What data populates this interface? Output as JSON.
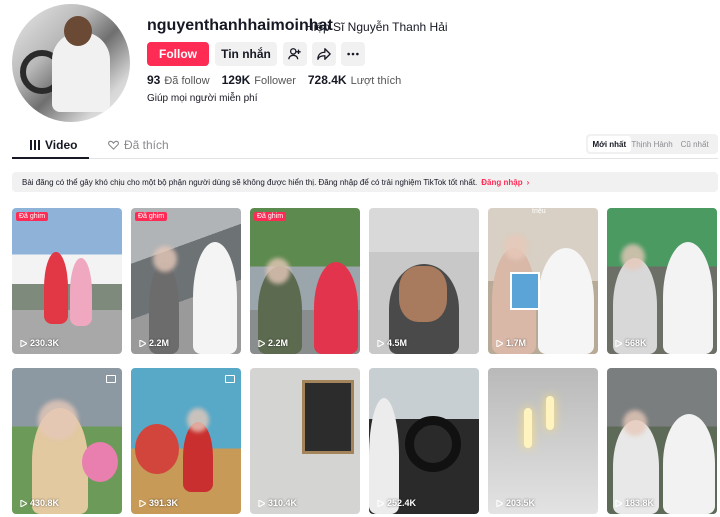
{
  "profile": {
    "username": "nguyenthanhhaimoinhat",
    "nickname": "Hiệp Sĩ Nguyễn Thanh Hải",
    "follow_label": "Follow",
    "message_label": "Tin nhắn",
    "stats": {
      "following_count": "93",
      "following_label": "Đã follow",
      "followers_count": "129K",
      "followers_label": "Follower",
      "likes_count": "728.4K",
      "likes_label": "Lượt thích"
    },
    "bio": "Giúp mọi người miễn phí"
  },
  "tabs": {
    "video": "Video",
    "liked": "Đã thích"
  },
  "sort": {
    "latest": "Mới nhất",
    "popular": "Thịnh Hành",
    "oldest": "Cũ nhất"
  },
  "notice": {
    "text": "Bài đăng có thể gây khó chịu cho một bộ phận người dùng sẽ không được hiển thị. Đăng nhập để có trải nghiệm TikTok tốt nhất.",
    "login": "Đăng nhập"
  },
  "videos": [
    {
      "views": "230.3K",
      "pinned": "Đã ghim"
    },
    {
      "views": "2.2M",
      "pinned": "Đã ghim"
    },
    {
      "views": "2.2M",
      "pinned": "Đã ghim"
    },
    {
      "views": "4.5M"
    },
    {
      "views": "1.7M",
      "overlay_text": "triệu"
    },
    {
      "views": "568K"
    },
    {
      "views": "430.8K"
    },
    {
      "views": "391.3K"
    },
    {
      "views": "310.4K"
    },
    {
      "views": "252.4K"
    },
    {
      "views": "203.5K"
    },
    {
      "views": "183.8K"
    }
  ],
  "colors": {
    "accent": "#fe2c55",
    "text": "#161823",
    "muted": "#8a8b91",
    "surface": "#f1f1f2"
  }
}
